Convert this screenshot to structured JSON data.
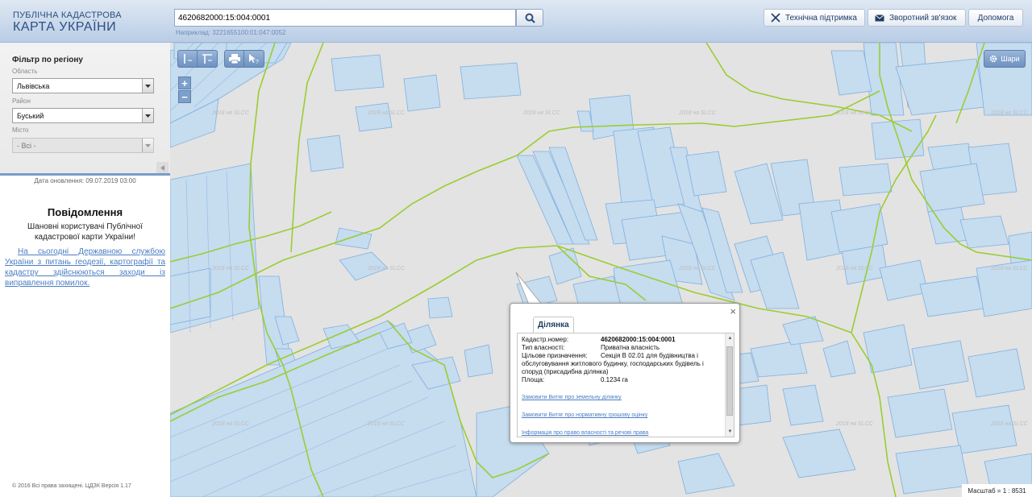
{
  "header": {
    "logo_line1": "ПУБЛІЧНА КАДАСТРОВА",
    "logo_line2": "КАРТА УКРАЇНИ",
    "search_value": "4620682000:15:004:0001",
    "search_example": "Наприклад: 3221655100:01:047:0052",
    "buttons": {
      "support": "Технічна підтримка",
      "feedback": "Зворотний зв'язок",
      "help": "Допомога"
    }
  },
  "sidebar": {
    "filter_title": "Фільтр по регіону",
    "region_label": "Область",
    "region_value": "Львівська",
    "district_label": "Район",
    "district_value": "Буський",
    "city_label": "Місто",
    "city_value": "- Всі -",
    "update_date": "Дата оновлення: 09.07.2019 03:00",
    "notice_title": "Повідомлення",
    "notice_text": "Шановні користувачі Публічної кадастрової карти України!",
    "notice_link": "На сьогодні Державною службою України з питань геодезії, картографії та кадастру здійснюються заходи із виправлення помилок.",
    "copyright": "© 2016 Всі права захищені. ЦДЗК Версія 1.17"
  },
  "map": {
    "layers_button": "Шари",
    "scale_text": "Масштаб = 1 : 8531",
    "watermark": "2018 ня SLCC",
    "zoom_in": "+",
    "zoom_out": "−"
  },
  "popup": {
    "tab": "Ділянка",
    "close": "×",
    "fields": [
      {
        "key": "Кадастр.номер:",
        "value": "4620682000:15:004:0001"
      },
      {
        "key": "Тип власності:",
        "value": "Приватна власність"
      },
      {
        "key": "Цільове призначення:",
        "value": "Секція В 02.01 для будівництва і"
      }
    ],
    "purpose_rest": "обслуговування житлового будинку, господарських будівель і споруд (присадибна ділянка)",
    "area_label": "Площа:",
    "area_value": "0.1234 га",
    "links": [
      "Замовити Витяг про земельну ділянку",
      "Замовити Витяг про нормативну грошову оцінку",
      "Інформація про право власності та речові права"
    ]
  },
  "colors": {
    "header_bg": "#c9d9ed",
    "map_bg": "#e3e3e3",
    "parcel_fill": "#c6dcef",
    "parcel_stroke": "#7fb0df",
    "boundary": "#9acd32",
    "link": "#4a7ec2"
  }
}
